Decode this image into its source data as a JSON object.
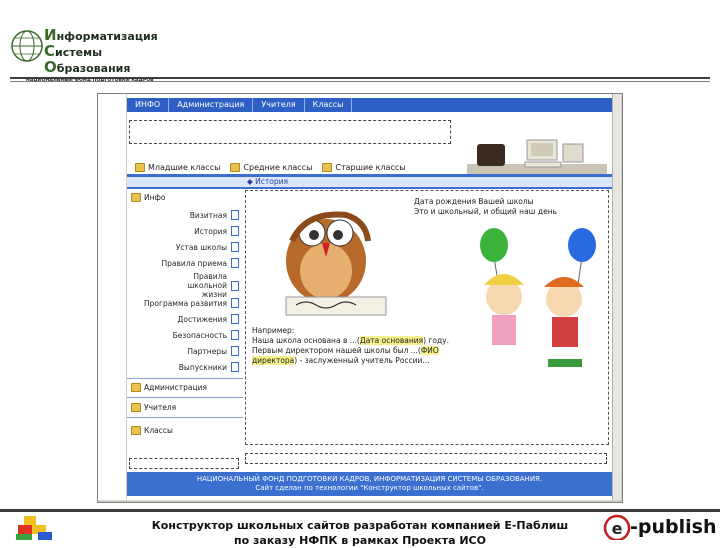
{
  "logo": {
    "lines": [
      {
        "cap": "И",
        "rest": "нформатизация"
      },
      {
        "cap": "С",
        "rest": "истемы"
      },
      {
        "cap": "О",
        "rest": "бразования"
      }
    ],
    "subtitle": "НАЦИОНАЛЬНЫЙ ФОНД ПОДГОТОВКИ КАДРОВ"
  },
  "site": {
    "nav_tabs": [
      "ИНФО",
      "Администрация",
      "Учителя",
      "Классы"
    ],
    "sub_tabs": [
      "Младшие классы",
      "Средние классы",
      "Старшие классы"
    ],
    "breadcrumb": "История",
    "menu": {
      "sections": [
        "Инфо",
        "Администрация",
        "Учителя",
        "Классы"
      ],
      "items": [
        "Визитная",
        "История",
        "Устав школы",
        "Правила приема",
        "Правила школьной жизни",
        "Программа развития",
        "Достижения",
        "Безопасность",
        "Партнеры",
        "Выпускники"
      ]
    },
    "content": {
      "birth_line1": "Дата рождения Вашей школы",
      "birth_line2": "Это и школьный, и общий наш день",
      "example_title": "Например:",
      "example_p1": "Наша школа основана в ...(",
      "example_hl1": "Дата основания",
      "example_p2": ") году. Первым директором нашей школы был ...(",
      "example_hl2": "ФИО директора",
      "example_p3": ") - заслуженный учитель России..."
    },
    "footer_line1": "НАЦИОНАЛЬНЫЙ ФОНД ПОДГОТОВКИ КАДРОВ, ИНФОРМАТИЗАЦИЯ СИСТЕМЫ ОБРАЗОВАНИЯ.",
    "footer_line2": "Сайт сделан по технологии \"Конструктор школьных сайтов\"."
  },
  "bottom": {
    "line1": "Конструктор школьных сайтов разработан компанией Е-Паблиш",
    "line2": "по заказу НФПК в рамках Проекта ИСО",
    "epublish_text": "-publish",
    "epublish_prefix": "e"
  },
  "colors": {
    "site_blue": "#3b6fd0",
    "rule_dark": "#3c3c3c",
    "highlight": "#f6f08a"
  }
}
